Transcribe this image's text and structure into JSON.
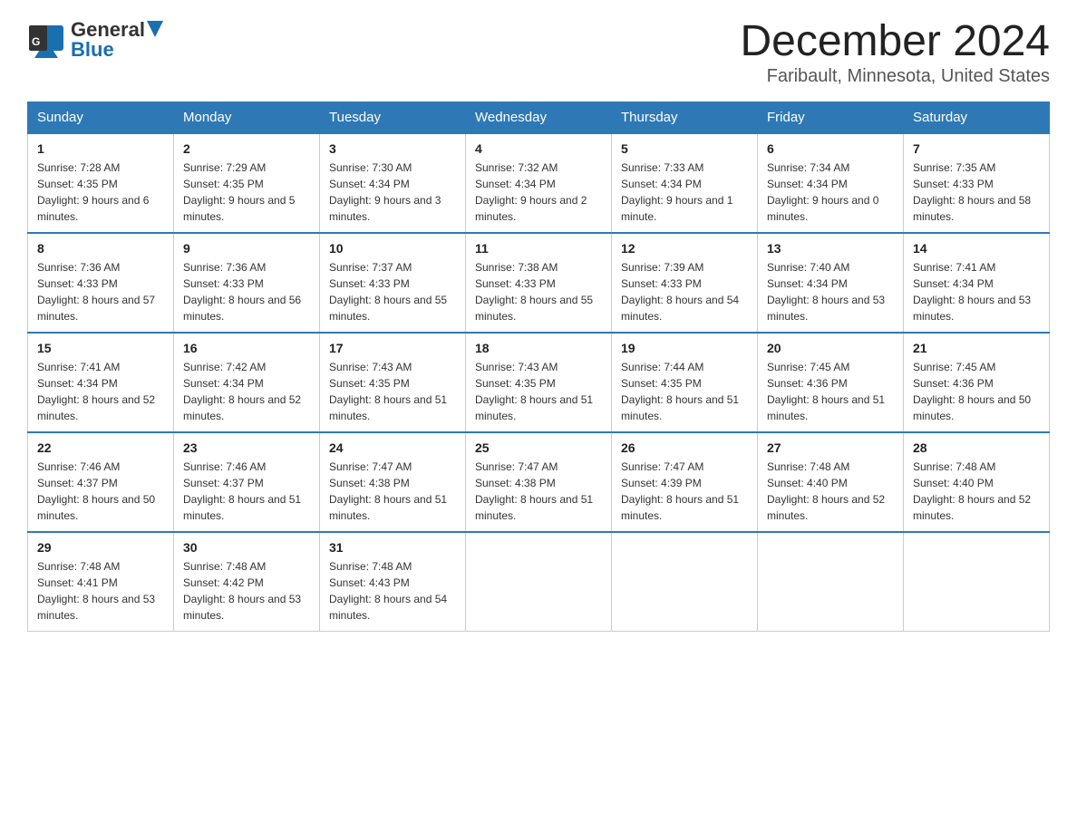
{
  "header": {
    "logo_general": "General",
    "logo_blue": "Blue",
    "month_title": "December 2024",
    "location": "Faribault, Minnesota, United States"
  },
  "weekdays": [
    "Sunday",
    "Monday",
    "Tuesday",
    "Wednesday",
    "Thursday",
    "Friday",
    "Saturday"
  ],
  "weeks": [
    [
      {
        "day": "1",
        "sunrise": "7:28 AM",
        "sunset": "4:35 PM",
        "daylight": "9 hours and 6 minutes."
      },
      {
        "day": "2",
        "sunrise": "7:29 AM",
        "sunset": "4:35 PM",
        "daylight": "9 hours and 5 minutes."
      },
      {
        "day": "3",
        "sunrise": "7:30 AM",
        "sunset": "4:34 PM",
        "daylight": "9 hours and 3 minutes."
      },
      {
        "day": "4",
        "sunrise": "7:32 AM",
        "sunset": "4:34 PM",
        "daylight": "9 hours and 2 minutes."
      },
      {
        "day": "5",
        "sunrise": "7:33 AM",
        "sunset": "4:34 PM",
        "daylight": "9 hours and 1 minute."
      },
      {
        "day": "6",
        "sunrise": "7:34 AM",
        "sunset": "4:34 PM",
        "daylight": "9 hours and 0 minutes."
      },
      {
        "day": "7",
        "sunrise": "7:35 AM",
        "sunset": "4:33 PM",
        "daylight": "8 hours and 58 minutes."
      }
    ],
    [
      {
        "day": "8",
        "sunrise": "7:36 AM",
        "sunset": "4:33 PM",
        "daylight": "8 hours and 57 minutes."
      },
      {
        "day": "9",
        "sunrise": "7:36 AM",
        "sunset": "4:33 PM",
        "daylight": "8 hours and 56 minutes."
      },
      {
        "day": "10",
        "sunrise": "7:37 AM",
        "sunset": "4:33 PM",
        "daylight": "8 hours and 55 minutes."
      },
      {
        "day": "11",
        "sunrise": "7:38 AM",
        "sunset": "4:33 PM",
        "daylight": "8 hours and 55 minutes."
      },
      {
        "day": "12",
        "sunrise": "7:39 AM",
        "sunset": "4:33 PM",
        "daylight": "8 hours and 54 minutes."
      },
      {
        "day": "13",
        "sunrise": "7:40 AM",
        "sunset": "4:34 PM",
        "daylight": "8 hours and 53 minutes."
      },
      {
        "day": "14",
        "sunrise": "7:41 AM",
        "sunset": "4:34 PM",
        "daylight": "8 hours and 53 minutes."
      }
    ],
    [
      {
        "day": "15",
        "sunrise": "7:41 AM",
        "sunset": "4:34 PM",
        "daylight": "8 hours and 52 minutes."
      },
      {
        "day": "16",
        "sunrise": "7:42 AM",
        "sunset": "4:34 PM",
        "daylight": "8 hours and 52 minutes."
      },
      {
        "day": "17",
        "sunrise": "7:43 AM",
        "sunset": "4:35 PM",
        "daylight": "8 hours and 51 minutes."
      },
      {
        "day": "18",
        "sunrise": "7:43 AM",
        "sunset": "4:35 PM",
        "daylight": "8 hours and 51 minutes."
      },
      {
        "day": "19",
        "sunrise": "7:44 AM",
        "sunset": "4:35 PM",
        "daylight": "8 hours and 51 minutes."
      },
      {
        "day": "20",
        "sunrise": "7:45 AM",
        "sunset": "4:36 PM",
        "daylight": "8 hours and 51 minutes."
      },
      {
        "day": "21",
        "sunrise": "7:45 AM",
        "sunset": "4:36 PM",
        "daylight": "8 hours and 50 minutes."
      }
    ],
    [
      {
        "day": "22",
        "sunrise": "7:46 AM",
        "sunset": "4:37 PM",
        "daylight": "8 hours and 50 minutes."
      },
      {
        "day": "23",
        "sunrise": "7:46 AM",
        "sunset": "4:37 PM",
        "daylight": "8 hours and 51 minutes."
      },
      {
        "day": "24",
        "sunrise": "7:47 AM",
        "sunset": "4:38 PM",
        "daylight": "8 hours and 51 minutes."
      },
      {
        "day": "25",
        "sunrise": "7:47 AM",
        "sunset": "4:38 PM",
        "daylight": "8 hours and 51 minutes."
      },
      {
        "day": "26",
        "sunrise": "7:47 AM",
        "sunset": "4:39 PM",
        "daylight": "8 hours and 51 minutes."
      },
      {
        "day": "27",
        "sunrise": "7:48 AM",
        "sunset": "4:40 PM",
        "daylight": "8 hours and 52 minutes."
      },
      {
        "day": "28",
        "sunrise": "7:48 AM",
        "sunset": "4:40 PM",
        "daylight": "8 hours and 52 minutes."
      }
    ],
    [
      {
        "day": "29",
        "sunrise": "7:48 AM",
        "sunset": "4:41 PM",
        "daylight": "8 hours and 53 minutes."
      },
      {
        "day": "30",
        "sunrise": "7:48 AM",
        "sunset": "4:42 PM",
        "daylight": "8 hours and 53 minutes."
      },
      {
        "day": "31",
        "sunrise": "7:48 AM",
        "sunset": "4:43 PM",
        "daylight": "8 hours and 54 minutes."
      },
      null,
      null,
      null,
      null
    ]
  ]
}
